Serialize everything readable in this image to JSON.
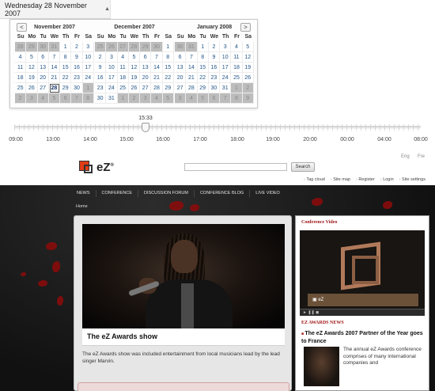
{
  "date_header": {
    "label": "Wednesday 28 November 2007",
    "dropdown_icon": "chevron-down-icon"
  },
  "calendar": {
    "prev_label": "<",
    "next_label": ">",
    "weekday_labels": [
      "Su",
      "Mo",
      "Tu",
      "We",
      "Th",
      "Fr",
      "Sa"
    ],
    "selected_date": "28",
    "months": [
      {
        "title": "November 2007",
        "days": [
          {
            "d": "28",
            "muted": true
          },
          {
            "d": "29",
            "muted": true
          },
          {
            "d": "30",
            "muted": true
          },
          {
            "d": "31",
            "muted": true
          },
          {
            "d": "1"
          },
          {
            "d": "2"
          },
          {
            "d": "3"
          },
          {
            "d": "4"
          },
          {
            "d": "5"
          },
          {
            "d": "6"
          },
          {
            "d": "7"
          },
          {
            "d": "8"
          },
          {
            "d": "9"
          },
          {
            "d": "10"
          },
          {
            "d": "11"
          },
          {
            "d": "12"
          },
          {
            "d": "13"
          },
          {
            "d": "14"
          },
          {
            "d": "15"
          },
          {
            "d": "16"
          },
          {
            "d": "17"
          },
          {
            "d": "18"
          },
          {
            "d": "19"
          },
          {
            "d": "20"
          },
          {
            "d": "21"
          },
          {
            "d": "22"
          },
          {
            "d": "23"
          },
          {
            "d": "24"
          },
          {
            "d": "25"
          },
          {
            "d": "26"
          },
          {
            "d": "27"
          },
          {
            "d": "28",
            "selected": true
          },
          {
            "d": "29"
          },
          {
            "d": "30"
          },
          {
            "d": "1",
            "muted": true
          },
          {
            "d": "2",
            "muted": true
          },
          {
            "d": "3",
            "muted": true
          },
          {
            "d": "4",
            "muted": true
          },
          {
            "d": "5",
            "muted": true
          },
          {
            "d": "6",
            "muted": true
          },
          {
            "d": "7",
            "muted": true
          },
          {
            "d": "8",
            "muted": true
          }
        ]
      },
      {
        "title": "December 2007",
        "days": [
          {
            "d": "25",
            "muted": true
          },
          {
            "d": "26",
            "muted": true
          },
          {
            "d": "27",
            "muted": true
          },
          {
            "d": "28",
            "muted": true
          },
          {
            "d": "29",
            "muted": true
          },
          {
            "d": "30",
            "muted": true
          },
          {
            "d": "1"
          },
          {
            "d": "2"
          },
          {
            "d": "3"
          },
          {
            "d": "4"
          },
          {
            "d": "5"
          },
          {
            "d": "6"
          },
          {
            "d": "7"
          },
          {
            "d": "8"
          },
          {
            "d": "9"
          },
          {
            "d": "10"
          },
          {
            "d": "11"
          },
          {
            "d": "12"
          },
          {
            "d": "13"
          },
          {
            "d": "14"
          },
          {
            "d": "15"
          },
          {
            "d": "16"
          },
          {
            "d": "17"
          },
          {
            "d": "18"
          },
          {
            "d": "19"
          },
          {
            "d": "20"
          },
          {
            "d": "21"
          },
          {
            "d": "22"
          },
          {
            "d": "23"
          },
          {
            "d": "24"
          },
          {
            "d": "25"
          },
          {
            "d": "26"
          },
          {
            "d": "27"
          },
          {
            "d": "28"
          },
          {
            "d": "29"
          },
          {
            "d": "30"
          },
          {
            "d": "31"
          },
          {
            "d": "1",
            "muted": true
          },
          {
            "d": "2",
            "muted": true
          },
          {
            "d": "3",
            "muted": true
          },
          {
            "d": "4",
            "muted": true
          },
          {
            "d": "5",
            "muted": true
          }
        ]
      },
      {
        "title": "January 2008",
        "days": [
          {
            "d": "30",
            "muted": true
          },
          {
            "d": "31",
            "muted": true
          },
          {
            "d": "1"
          },
          {
            "d": "2"
          },
          {
            "d": "3"
          },
          {
            "d": "4"
          },
          {
            "d": "5"
          },
          {
            "d": "6"
          },
          {
            "d": "7"
          },
          {
            "d": "8"
          },
          {
            "d": "9"
          },
          {
            "d": "10"
          },
          {
            "d": "11"
          },
          {
            "d": "12"
          },
          {
            "d": "13"
          },
          {
            "d": "14"
          },
          {
            "d": "15"
          },
          {
            "d": "16"
          },
          {
            "d": "17"
          },
          {
            "d": "18"
          },
          {
            "d": "19"
          },
          {
            "d": "20"
          },
          {
            "d": "21"
          },
          {
            "d": "22"
          },
          {
            "d": "23"
          },
          {
            "d": "24"
          },
          {
            "d": "25"
          },
          {
            "d": "26"
          },
          {
            "d": "27"
          },
          {
            "d": "28"
          },
          {
            "d": "29"
          },
          {
            "d": "30"
          },
          {
            "d": "31"
          },
          {
            "d": "1",
            "muted": true
          },
          {
            "d": "2",
            "muted": true
          },
          {
            "d": "3",
            "muted": true
          },
          {
            "d": "4",
            "muted": true
          },
          {
            "d": "5",
            "muted": true
          },
          {
            "d": "6",
            "muted": true
          },
          {
            "d": "7",
            "muted": true
          },
          {
            "d": "8",
            "muted": true
          },
          {
            "d": "9",
            "muted": true
          }
        ]
      }
    ]
  },
  "slider": {
    "current_time": "15:33",
    "position_fraction": 0.323,
    "time_labels": [
      "09:00",
      "13:00",
      "14:00",
      "15:00",
      "16:00",
      "17:00",
      "18:00",
      "19:00",
      "20:00",
      "00:00",
      "04:00",
      "08:00"
    ]
  },
  "site": {
    "languages": [
      "Eng",
      "Fre"
    ],
    "logo_text": "eZ",
    "search_placeholder": "",
    "search_button": "Search",
    "util_links": [
      "Tag cloud",
      "Site map",
      "Register",
      "Login",
      "Site settings"
    ],
    "nav_items": [
      "NEWS",
      "CONFERENCE",
      "DISCUSSION FORUM",
      "CONFERENCE BLOG",
      "LIVE VIDEO"
    ],
    "breadcrumb": "Home",
    "main_article": {
      "title": "The eZ Awards show",
      "text": "The eZ Awards show was included entertainment from local musicians lead by the lead singer Marvin."
    },
    "right_column": {
      "video_heading": "Conference Video",
      "news_heading": "EZ AWARDS NEWS",
      "award_title": "The eZ Awards 2007 Partner of the Year goes to France",
      "award_text": "The annual eZ Awards conference comprises of many international companies and"
    },
    "colors": {
      "accent_red": "#a11616",
      "dark_bg": "#161616",
      "calendar_day": "#225588"
    }
  }
}
